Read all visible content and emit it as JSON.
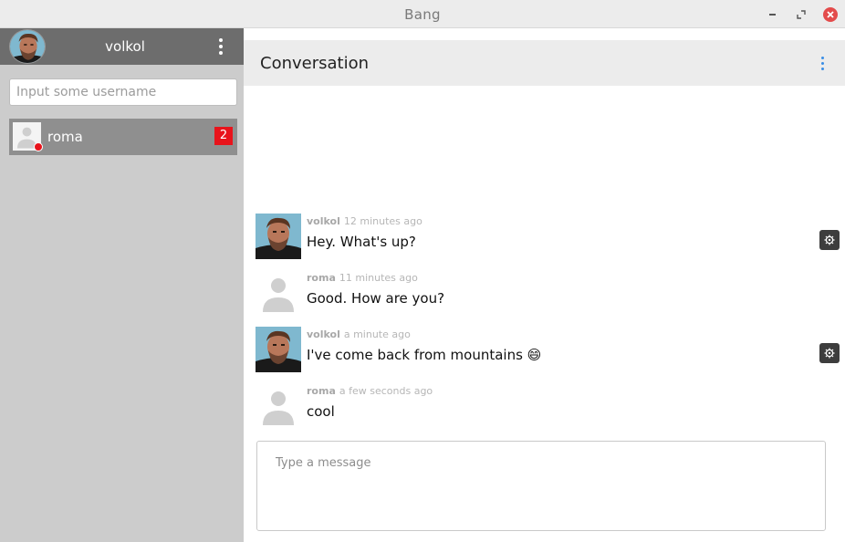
{
  "window": {
    "title": "Bang"
  },
  "sidebar": {
    "current_user": {
      "name": "volkol"
    },
    "search": {
      "placeholder": "Input some username",
      "value": ""
    },
    "contacts": [
      {
        "name": "roma",
        "unread": "2",
        "status": "offline"
      }
    ]
  },
  "conversation": {
    "title": "Conversation",
    "messages": [
      {
        "author": "volkol",
        "time": "12 minutes ago",
        "text": "Hey. What's up?"
      },
      {
        "author": "roma",
        "time": "11 minutes ago",
        "text": "Good. How are you?"
      },
      {
        "author": "volkol",
        "time": "a minute ago",
        "text": "I've come back from mountains 😄"
      },
      {
        "author": "roma",
        "time": "a few seconds ago",
        "text": "cool"
      }
    ],
    "composer": {
      "placeholder": "Type a message",
      "value": ""
    }
  },
  "colors": {
    "status_offline": "#e8131b",
    "unread_badge": "#e8131b",
    "accent": "#3a8ee6",
    "sidebar_bg": "#cccccc",
    "sidebar_header": "#6d6d6d"
  }
}
